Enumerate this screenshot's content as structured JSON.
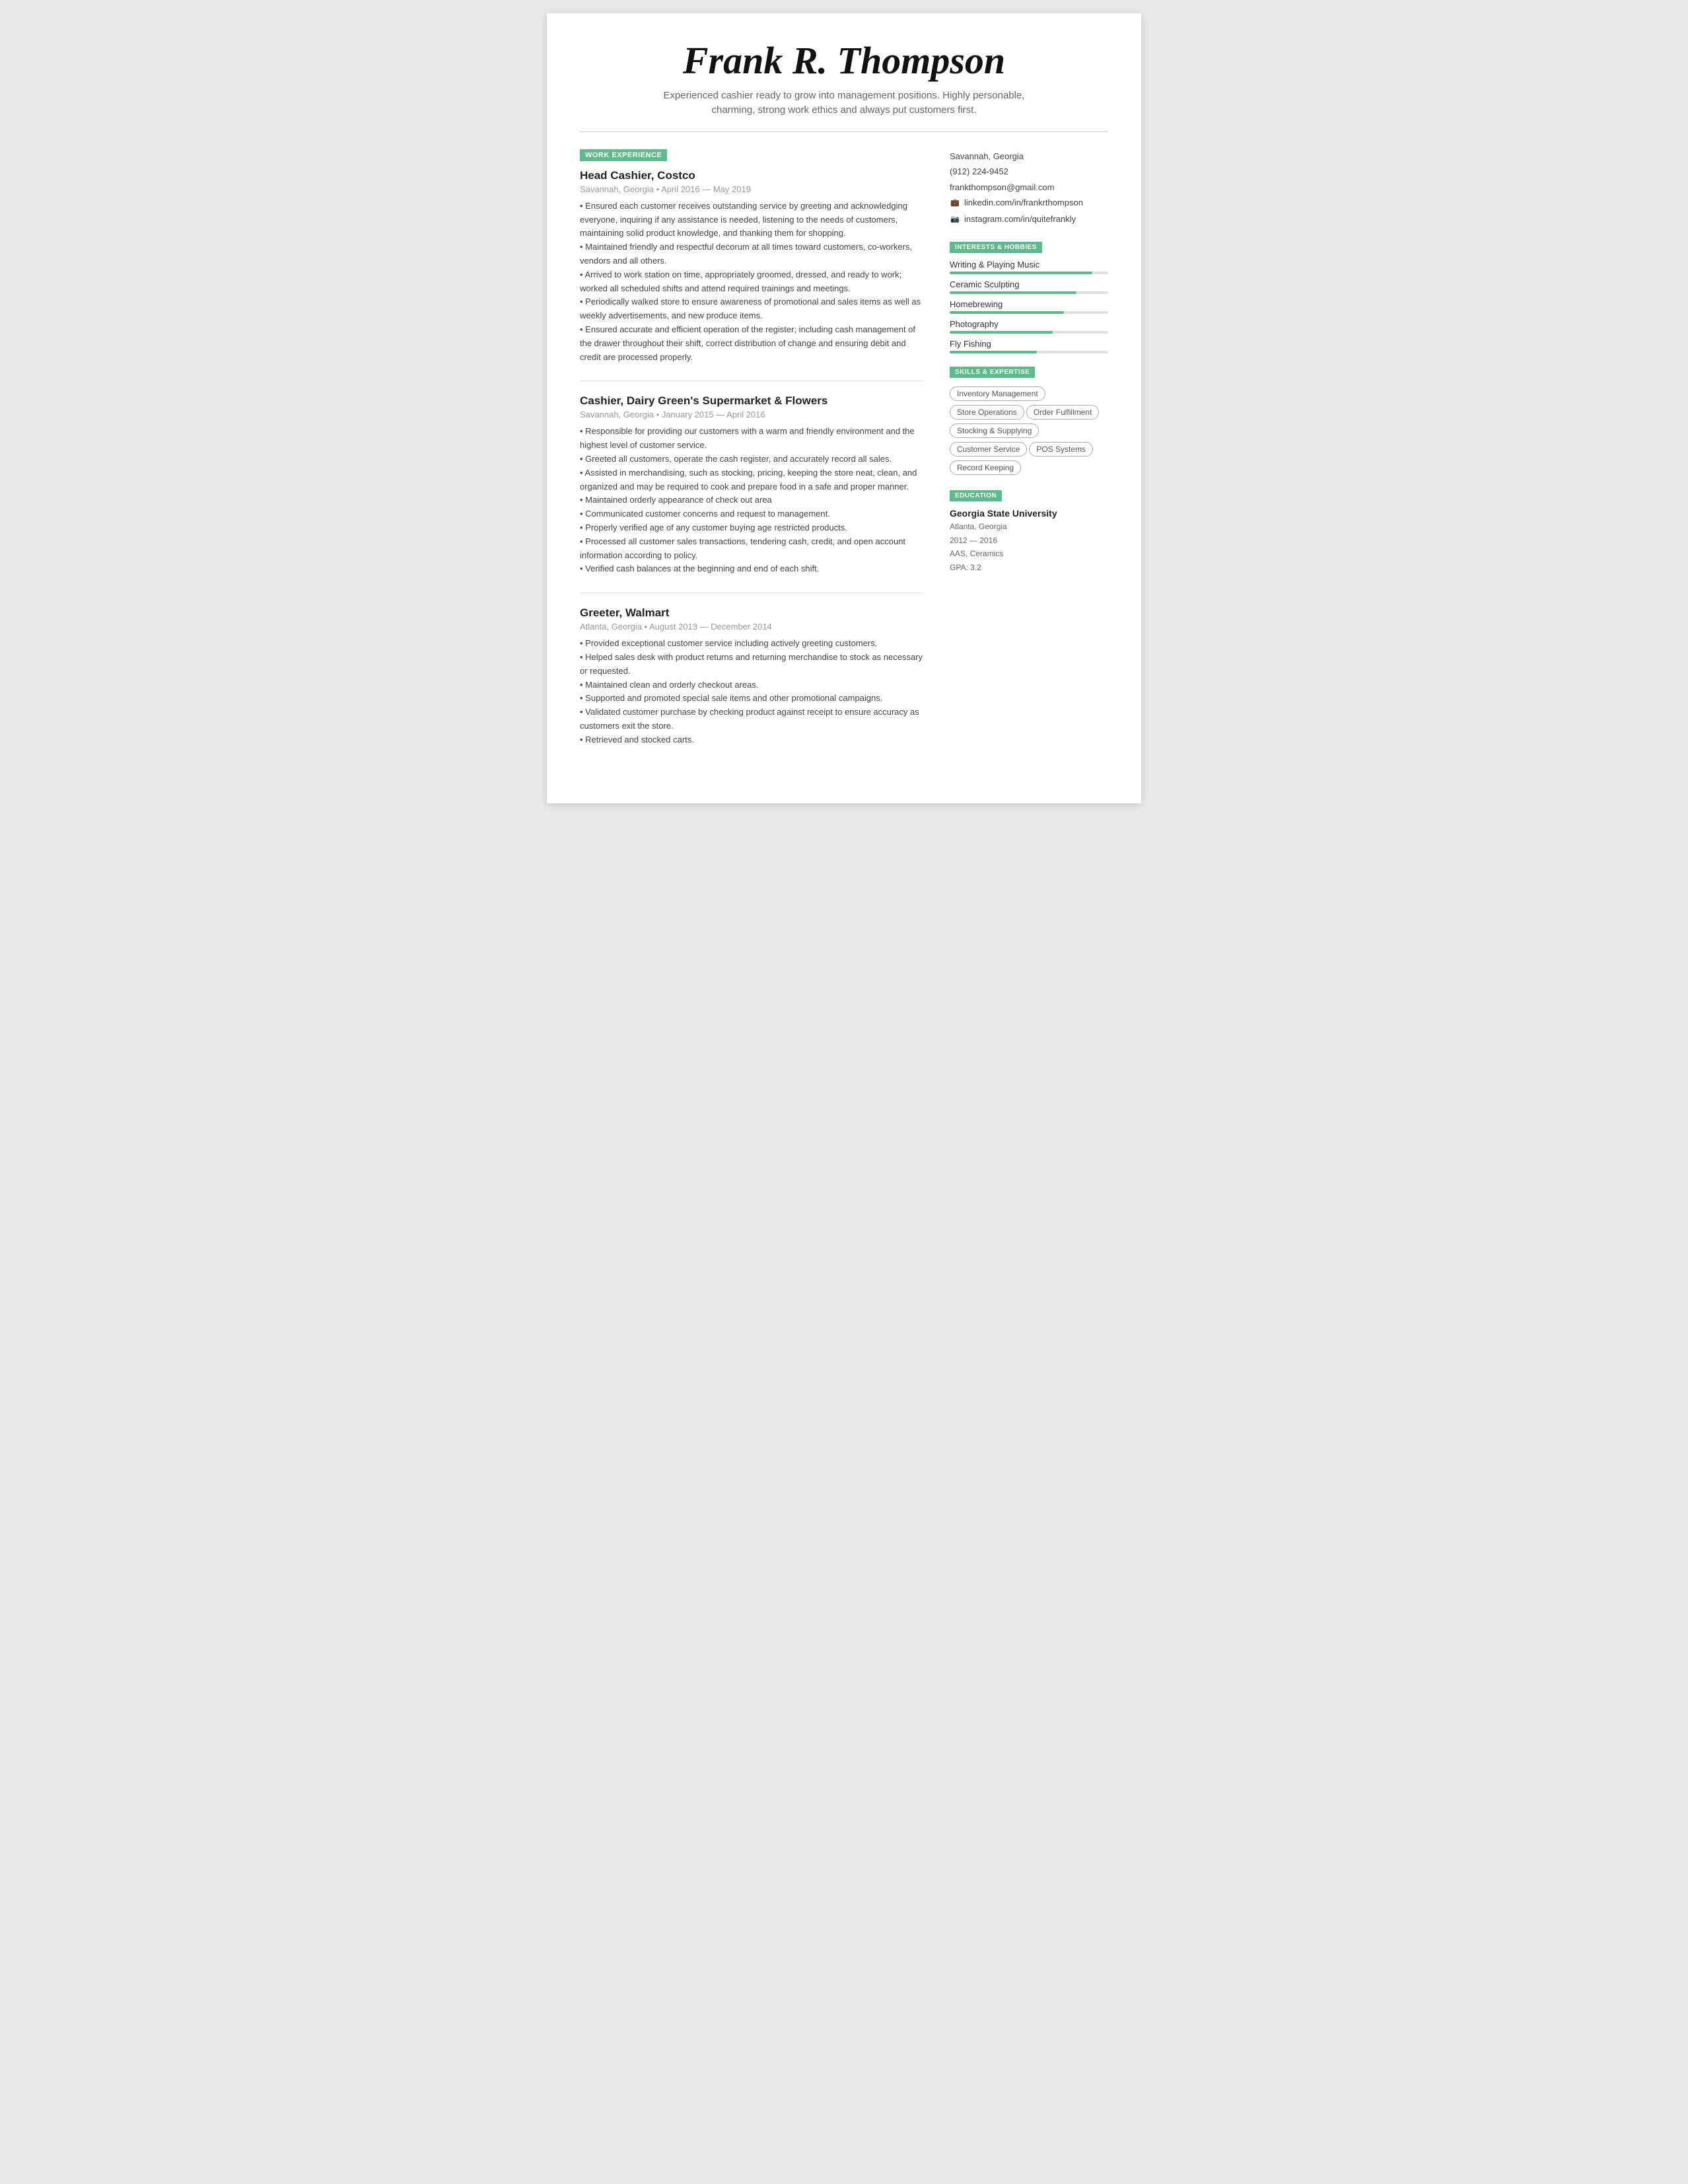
{
  "header": {
    "name": "Frank R. Thompson",
    "tagline": "Experienced cashier ready to grow into management positions. Highly personable, charming, strong work ethics and always put customers first."
  },
  "main": {
    "work_experience_label": "WORK EXPERIENCE",
    "jobs": [
      {
        "title": "Head Cashier, Costco",
        "location_date": "Savannah, Georgia • April 2016 — May 2019",
        "bullets": [
          "• Ensured each customer receives outstanding service by greeting and acknowledging everyone, inquiring if any assistance is needed, listening to the needs of customers, maintaining solid product knowledge, and thanking them for shopping.",
          "• Maintained friendly and respectful decorum at all times toward customers, co-workers, vendors and all others.",
          "• Arrived to work station on time, appropriately groomed, dressed, and ready to work; worked all scheduled shifts and attend required trainings and meetings.",
          "• Periodically walked store to ensure awareness of promotional and sales items as well as weekly advertisements, and new produce items.",
          "• Ensured accurate and efficient operation of the register; including cash management of the drawer throughout their shift, correct distribution of change and ensuring debit and credit are processed properly."
        ]
      },
      {
        "title": "Cashier, Dairy Green's Supermarket & Flowers",
        "location_date": "Savannah, Georgia • January 2015 — April 2016",
        "bullets": [
          "• Responsible for providing our customers with a warm and friendly environment and the highest level of customer service.",
          "• Greeted all customers, operate the cash register, and accurately record all sales.",
          "• Assisted in merchandising, such as stocking, pricing, keeping the store neat, clean, and organized and may be required to cook and prepare food in a safe and proper manner.",
          "• Maintained orderly appearance of check out area",
          "• Communicated customer concerns and request to management.",
          "• Properly verified age of any customer buying age restricted products.",
          "• Processed all customer sales transactions, tendering cash, credit, and open account information according to policy.",
          "• Verified cash balances at the beginning and end of each shift."
        ]
      },
      {
        "title": "Greeter, Walmart",
        "location_date": "Atlanta, Georgia • August 2013 — December 2014",
        "bullets": [
          "• Provided exceptional customer service including actively greeting customers.",
          "• Helped sales desk with product returns and returning merchandise to stock as necessary or requested.",
          "• Maintained clean and orderly checkout areas.",
          "• Supported and promoted special sale items and other promotional campaigns.",
          "• Validated customer purchase by checking product against receipt to ensure accuracy as customers exit the store.",
          "• Retrieved and stocked carts."
        ]
      }
    ]
  },
  "sidebar": {
    "contact": {
      "location": "Savannah, Georgia",
      "phone": "(912) 224-9452",
      "email": "frankthompson@gmail.com",
      "linkedin": "linkedin.com/in/frankrthompson",
      "instagram": "instagram.com/in/quitefrankly"
    },
    "interests_label": "INTERESTS & HOBBIES",
    "interests": [
      {
        "name": "Writing & Playing Music",
        "pct": 90
      },
      {
        "name": "Ceramic Sculpting",
        "pct": 80
      },
      {
        "name": "Homebrewing",
        "pct": 72
      },
      {
        "name": "Photography",
        "pct": 65
      },
      {
        "name": "Fly Fishing",
        "pct": 55
      }
    ],
    "skills_label": "SKILLS & EXPERTISE",
    "skills": [
      "Inventory Management",
      "Store Operations",
      "Order Fulfillment",
      "Stocking & Supplying",
      "Customer Service",
      "POS Systems",
      "Record Keeping"
    ],
    "education_label": "EDUCATION",
    "education": {
      "school": "Georgia State University",
      "location": "Atlanta, Georgia",
      "dates": "2012 — 2016",
      "degree": "AAS, Ceramics",
      "gpa": "GPA: 3.2"
    }
  }
}
